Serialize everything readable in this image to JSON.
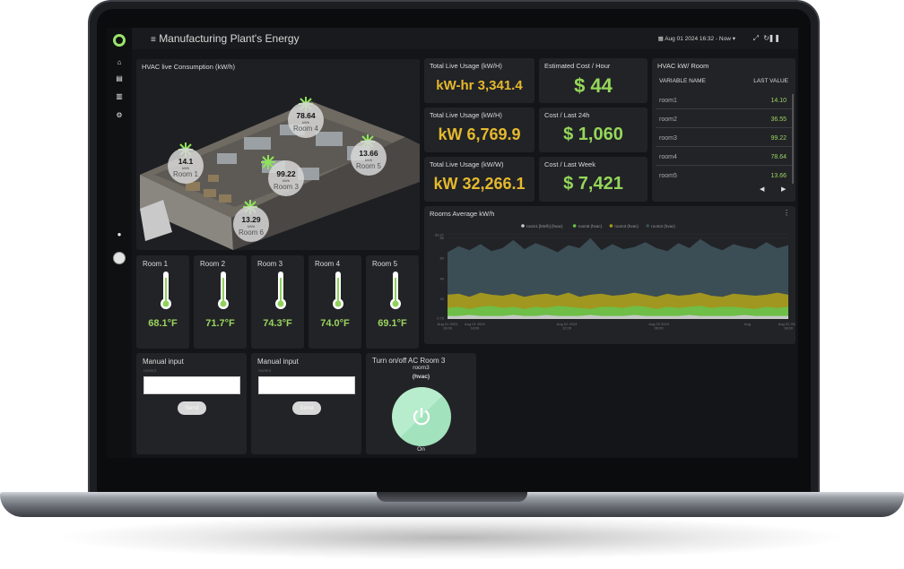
{
  "app": {
    "title": "Manufacturing Plant's Energy",
    "date_range": "Aug 01 2024 16:32 - Now"
  },
  "sidebar": {
    "items": [
      {
        "icon": "home-icon"
      },
      {
        "icon": "factory-icon"
      },
      {
        "icon": "folder-icon"
      },
      {
        "icon": "gear-icon"
      }
    ]
  },
  "floor_plan": {
    "title": "HVAC live Consumption (kW/h)",
    "rooms": [
      {
        "value": "78.64",
        "unit": "kWh",
        "name": "Room 4"
      },
      {
        "value": "14.1",
        "unit": "kWh",
        "name": "Room 1"
      },
      {
        "value": "13.66",
        "unit": "kWh",
        "name": "Room 5"
      },
      {
        "value": "99.22",
        "unit": "kWh",
        "name": "Room 3"
      },
      {
        "value": "13.29",
        "unit": "kWh",
        "name": "Room 6"
      }
    ]
  },
  "kpis": [
    {
      "label": "Total Live Usage (kW/H)",
      "value": "kW-hr 3,341.4",
      "color": "#e5b92c"
    },
    {
      "label": "Estimated Cost / Hour",
      "value": "$ 44",
      "color": "#95d75a"
    },
    {
      "label": "Total Live Usage (kW/H)",
      "value": "kW 6,769.9",
      "color": "#e5b92c"
    },
    {
      "label": "Cost / Last 24h",
      "value": "$ 1,060",
      "color": "#95d75a"
    },
    {
      "label": "Total Live Usage (kW/W)",
      "value": "kW 32,266.1",
      "color": "#e5b92c"
    },
    {
      "label": "Cost / Last Week",
      "value": "$ 7,421",
      "color": "#95d75a"
    }
  ],
  "hvac_table": {
    "title": "HVAC kW/ Room",
    "col_name": "VARIABLE NAME",
    "col_value": "LAST VALUE",
    "rows": [
      {
        "name": "room1",
        "value": "14.10"
      },
      {
        "name": "room2",
        "value": "36.55"
      },
      {
        "name": "room3",
        "value": "99.22"
      },
      {
        "name": "room4",
        "value": "78.64"
      },
      {
        "name": "room5",
        "value": "13.66"
      }
    ]
  },
  "rooms_average": {
    "title": "Rooms Average kW/h"
  },
  "chart_data": {
    "type": "area",
    "title": "Rooms Average kW/h",
    "series": [
      {
        "name": "room1 [kW/h] (hvac)",
        "color": "#c9cacc",
        "values": [
          3,
          3,
          4,
          3,
          3,
          3,
          4,
          3,
          3,
          4,
          3,
          3,
          3,
          4,
          3,
          3,
          3,
          4,
          3,
          3,
          3,
          3,
          4,
          3,
          3,
          3,
          3,
          4,
          3,
          3,
          3,
          3
        ]
      },
      {
        "name": "room5 (hvac)",
        "color": "#6cc04a",
        "values": [
          11,
          12,
          10,
          12,
          13,
          11,
          12,
          10,
          12,
          11,
          13,
          12,
          11,
          10,
          12,
          12,
          11,
          13,
          12,
          10,
          12,
          11,
          12,
          13,
          11,
          12,
          12,
          11,
          10,
          12,
          11,
          12
        ]
      },
      {
        "name": "room3 (hvac)",
        "color": "#a69a1c",
        "values": [
          24,
          25,
          22,
          26,
          24,
          23,
          25,
          22,
          24,
          25,
          23,
          26,
          22,
          24,
          25,
          23,
          24,
          26,
          24,
          22,
          25,
          23,
          24,
          26,
          23,
          22,
          25,
          24,
          23,
          24,
          26,
          24
        ]
      },
      {
        "name": "room2 (hvac)",
        "color": "#3b4d55",
        "values": [
          66,
          72,
          68,
          74,
          67,
          70,
          78,
          69,
          75,
          71,
          66,
          73,
          70,
          80,
          68,
          74,
          69,
          71,
          76,
          70,
          67,
          75,
          70,
          79,
          72,
          68,
          74,
          71,
          69,
          76,
          70,
          73
        ]
      }
    ],
    "x_ticks": [
      "Aug 01 2024 16:00",
      "Aug 01 2024 18:00",
      "Aug 02 2024 12:00",
      "Aug 02 2024 06:00",
      "Aug",
      "Aug 02 2024 18:00"
    ],
    "y_ticks": [
      "0.75",
      "20",
      "40",
      "60",
      "80",
      "83.37"
    ],
    "ylim": [
      0,
      85
    ],
    "legend": "top"
  },
  "rooms": [
    {
      "name": "Room 1",
      "temp": "68.1°F"
    },
    {
      "name": "Room 2",
      "temp": "71.7°F"
    },
    {
      "name": "Room 3",
      "temp": "74.3°F"
    },
    {
      "name": "Room 4",
      "temp": "74.0°F"
    },
    {
      "name": "Room 5",
      "temp": "69.1°F"
    }
  ],
  "manual_inputs": [
    {
      "label": "Manual input",
      "placeholder": "roomr2",
      "button": "Send"
    },
    {
      "label": "Manual input",
      "placeholder": "roomr4",
      "button": "Send"
    }
  ],
  "toggle": {
    "title": "Turn on/off AC Room 3",
    "device": "room3",
    "variable": "(hvac)",
    "state": "On"
  }
}
